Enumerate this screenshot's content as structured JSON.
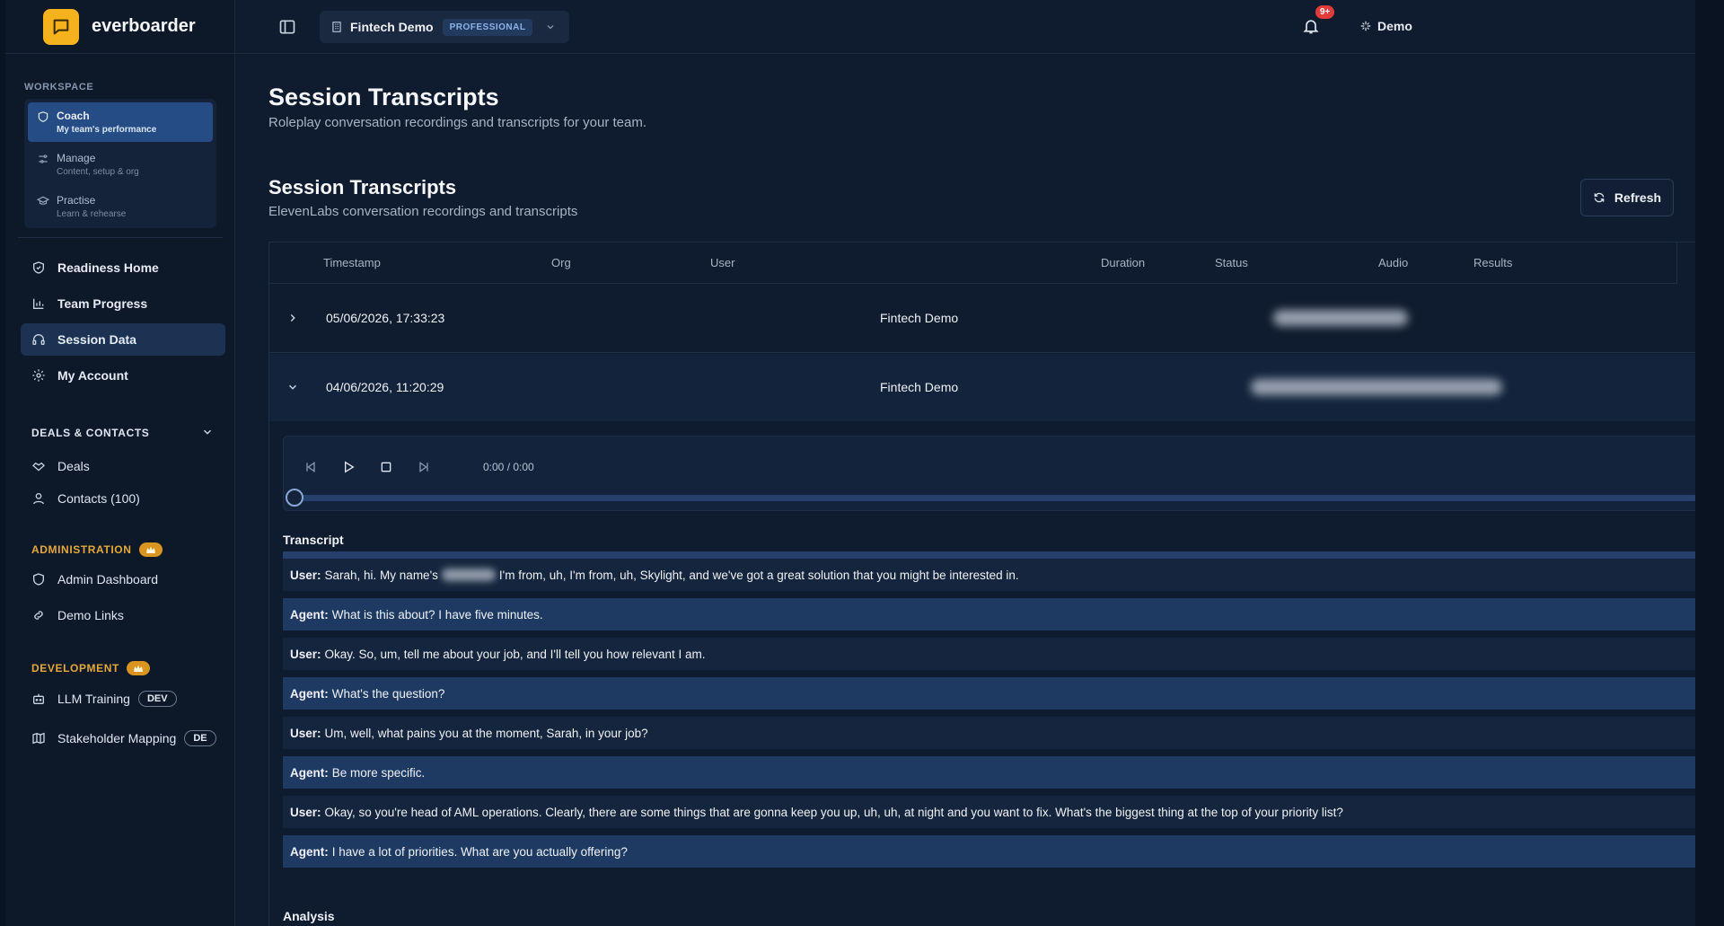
{
  "brand": {
    "name": "everboarder"
  },
  "header": {
    "org_name": "Fintech Demo",
    "plan": "PROFESSIONAL",
    "notifications": "9+",
    "user": "Demo"
  },
  "sidebar": {
    "workspace_title": "WORKSPACE",
    "workspace": [
      {
        "label": "Coach",
        "sub": "My team's performance"
      },
      {
        "label": "Manage",
        "sub": "Content, setup & org"
      },
      {
        "label": "Practise",
        "sub": "Learn & rehearse"
      }
    ],
    "nav": [
      {
        "label": "Readiness Home"
      },
      {
        "label": "Team Progress"
      },
      {
        "label": "Session Data"
      },
      {
        "label": "My Account"
      }
    ],
    "deals_group": "DEALS & CONTACTS",
    "deals": [
      {
        "label": "Deals"
      },
      {
        "label": "Contacts (100)"
      }
    ],
    "admin_group": "ADMINISTRATION",
    "admin": [
      {
        "label": "Admin Dashboard"
      },
      {
        "label": "Demo Links"
      }
    ],
    "dev_group": "DEVELOPMENT",
    "dev": [
      {
        "label": "LLM Training",
        "badge": "DEV"
      },
      {
        "label": "Stakeholder Mapping",
        "badge": "DE"
      }
    ]
  },
  "main": {
    "title": "Session Transcripts",
    "subtitle": "Roleplay conversation recordings and transcripts for your team.",
    "section_title": "Session Transcripts",
    "section_sub": "ElevenLabs conversation recordings and transcripts",
    "refresh_label": "Refresh",
    "columns": [
      "Timestamp",
      "Org",
      "User",
      "Duration",
      "Status",
      "Audio",
      "Results"
    ],
    "rows": [
      {
        "timestamp": "05/06/2026, 17:33:23",
        "org": "Fintech Demo"
      },
      {
        "timestamp": "04/06/2026, 11:20:29",
        "org": "Fintech Demo"
      }
    ],
    "player_time": "0:00 / 0:00",
    "transcript_title": "Transcript",
    "transcript": [
      {
        "speaker": "User:",
        "pre": "Sarah, hi. My name's",
        "post": "I'm from, uh, I'm from, uh, Skylight, and we've got a great solution that you might be interested in."
      },
      {
        "speaker": "Agent:",
        "text": "What is this about? I have five minutes."
      },
      {
        "speaker": "User:",
        "text": "Okay. So, um, tell me about your job, and I'll tell you how relevant I am."
      },
      {
        "speaker": "Agent:",
        "text": "What's the question?"
      },
      {
        "speaker": "User:",
        "text": "Um, well, what pains you at the moment, Sarah, in your job?"
      },
      {
        "speaker": "Agent:",
        "text": "Be more specific."
      },
      {
        "speaker": "User:",
        "text": "Okay, so you're head of AML operations. Clearly, there are some things that are gonna keep you up, uh, uh, at night and you want to fix. What's the biggest thing at the top of your priority list?"
      },
      {
        "speaker": "Agent:",
        "text": "I have a lot of priorities. What are you actually offering?"
      }
    ],
    "analysis_title": "Analysis"
  }
}
